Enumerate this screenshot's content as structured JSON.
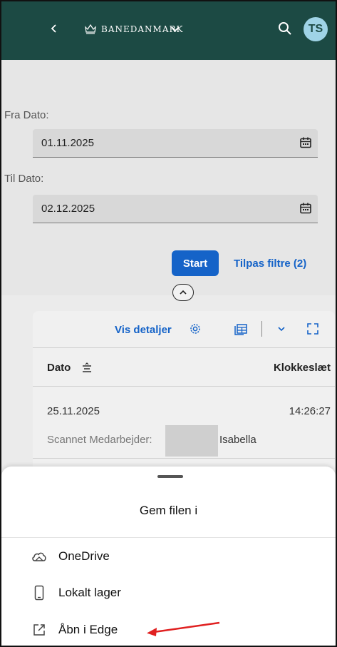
{
  "header": {
    "brand": "BANEDANMARK",
    "avatar_initials": "TS",
    "bg_color": "#1c4a44"
  },
  "filters": {
    "from_label": "Fra Dato:",
    "from_value": "01.11.2025",
    "to_label": "Til Dato:",
    "to_value": "02.12.2025",
    "start_label": "Start",
    "adapt_label": "Tilpas filtre (2)"
  },
  "table": {
    "details_label": "Vis detaljer",
    "columns": [
      "Dato",
      "Klokkeslæt"
    ],
    "rows": [
      {
        "date": "25.11.2025",
        "time": "14:26:27",
        "scanned_label": "Scannet Medarbejder:",
        "name": "Isabella"
      }
    ]
  },
  "sheet": {
    "title": "Gem filen i",
    "options": [
      {
        "label": "OneDrive",
        "icon": "cloud-icon"
      },
      {
        "label": "Lokalt lager",
        "icon": "phone-icon"
      },
      {
        "label": "Åbn i Edge",
        "icon": "open-external-icon"
      }
    ]
  },
  "colors": {
    "accent": "#1563c8",
    "annotation_arrow": "#e02020"
  }
}
